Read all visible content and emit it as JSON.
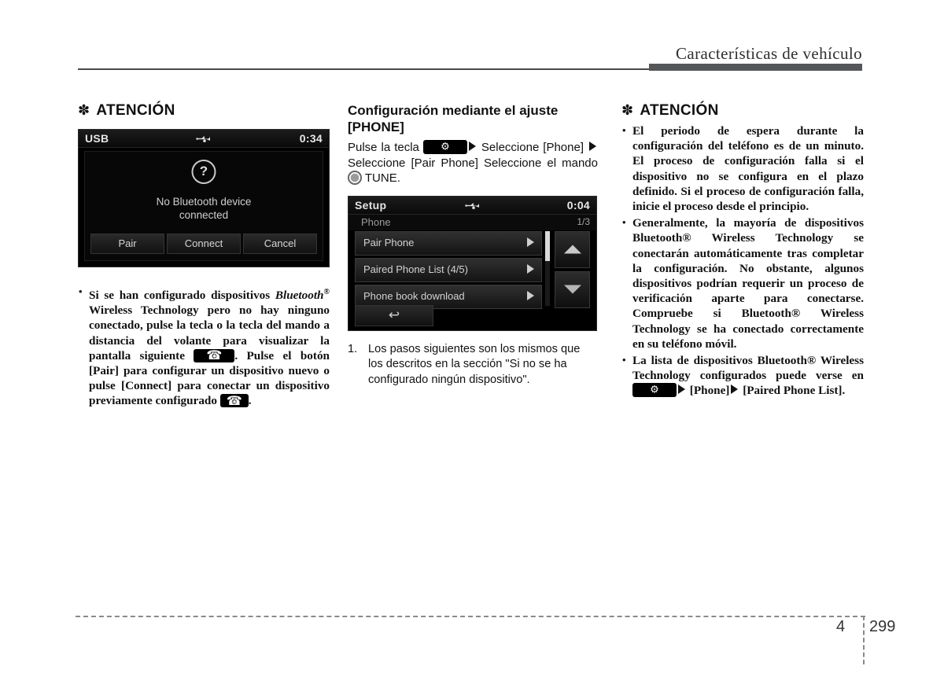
{
  "header": {
    "title": "Características de vehículo"
  },
  "left_column": {
    "attention_heading": "ATENCIÓN",
    "star_glyph": "✽",
    "screenshot": {
      "name": "bluetooth-not-connected-dialog",
      "status_left": "USB",
      "status_center_icon": "usb-icon",
      "status_right": "0:34",
      "dialog_icon": "question-mark-icon",
      "dialog_message_line1": "No Bluetooth device",
      "dialog_message_line2": "connected",
      "buttons": [
        "Pair",
        "Connect",
        "Cancel"
      ]
    },
    "bullets": [
      {
        "part1": "Si se han configurado dispositivos ",
        "italic1": "Bluetooth",
        "sup1": "®",
        "part2": " Wireless Technology pero no hay ninguno conectado, pulse la tecla  o la tecla  del mando a distancia del volante para visualizar la pantalla siguiente ",
        "icon1": "phone-key-icon",
        "part3": ". Pulse el botón [Pair] para configurar un dispositivo nuevo o pulse [Connect] para conectar un dispositivo previamente configurado ",
        "icon2": "phone-key-icon",
        "part4": "."
      }
    ]
  },
  "middle_column": {
    "heading_line1": "Configuración mediante el ajuste",
    "heading_line2": "[PHONE]",
    "instruction": {
      "seg1": "Pulse la tecla ",
      "icon1": "setup-key-icon",
      "arrow1": "play-triangle-icon",
      "seg2": " Seleccione [Phone] ",
      "arrow2": "play-triangle-icon",
      "seg3": " Seleccione [Pair Phone] Seleccione el mando ",
      "icon2": "tune-knob-icon",
      "seg4": " TUNE."
    },
    "screenshot": {
      "name": "setup-phone-menu",
      "status_left": "Setup",
      "status_center_icon": "usb-icon",
      "status_right": "0:04",
      "sub_left": "Phone",
      "sub_right": "1/3",
      "rows": [
        "Pair Phone",
        "Paired Phone List  (4/5)",
        "Phone book download"
      ],
      "scroll_up_icon": "triangle-up-icon",
      "scroll_down_icon": "triangle-down-icon",
      "back_icon": "back-arrow-icon"
    },
    "numbered": [
      {
        "number": "1.",
        "text": "Los pasos siguientes son los mismos que los descritos en la sección \"Si no se ha configurado ningún dispositivo\"."
      }
    ]
  },
  "right_column": {
    "attention_heading": "ATENCIÓN",
    "star_glyph": "✽",
    "bullets": [
      {
        "text": "El periodo de espera durante la configuración del teléfono es de un minuto. El proceso de configuración falla si el dispositivo no se configura en el plazo definido. Si el proceso de configuración falla, inicie el proceso desde el principio."
      },
      {
        "text": "Generalmente, la mayoría de dispositivos Bluetooth® Wireless Technology se conectarán automáticamente tras completar la configuración. No obstante, algunos dispositivos podrían requerir un proceso de verificación aparte para conectarse. Compruebe si Bluetooth® Wireless Technology se ha conectado correctamente en su teléfono móvil."
      },
      {
        "seg1": "La lista de dispositivos Bluetooth® Wireless Technology configurados puede verse en ",
        "icon1": "setup-key-icon",
        "arrow1": "play-triangle-icon",
        "seg2": " [Phone]",
        "arrow2": "play-triangle-icon",
        "seg3": " [Paired Phone List]."
      }
    ]
  },
  "footer": {
    "chapter": "4",
    "page": "299"
  }
}
